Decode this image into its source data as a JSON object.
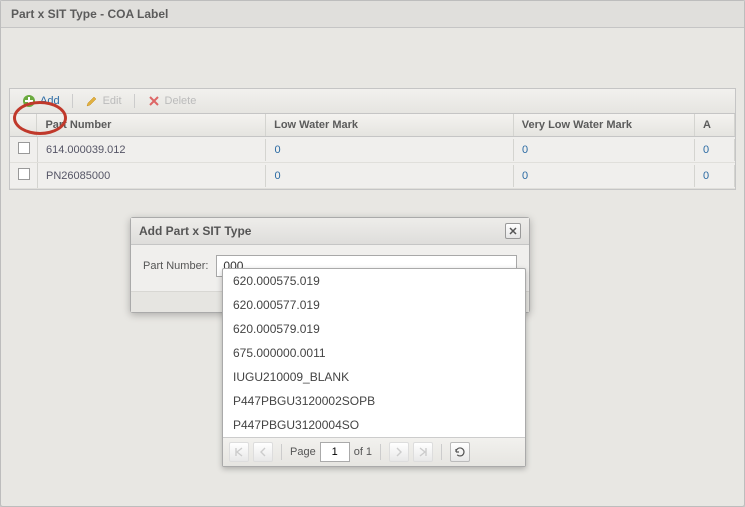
{
  "panel": {
    "title": "Part x SIT Type - COA Label"
  },
  "toolbar": {
    "add_label": "Add",
    "edit_label": "Edit",
    "delete_label": "Delete"
  },
  "grid": {
    "columns": {
      "part_number": "Part Number",
      "low_water": "Low Water Mark",
      "very_low_water": "Very Low Water Mark",
      "av": "A"
    },
    "rows": [
      {
        "part_number": "614.000039.012",
        "low_water": "0",
        "very_low_water": "0",
        "av": "0"
      },
      {
        "part_number": "PN26085000",
        "low_water": "0",
        "very_low_water": "0",
        "av": "0"
      }
    ]
  },
  "modal": {
    "title": "Add Part x SIT Type",
    "field_label": "Part Number:",
    "field_value": "000"
  },
  "dropdown": {
    "options": [
      "620.000575.019",
      "620.000577.019",
      "620.000579.019",
      "675.000000.0011",
      "IUGU210009_BLANK",
      "P447PBGU3120002SOPB",
      "P447PBGU3120004SO"
    ],
    "pager": {
      "page_label": "Page",
      "current": "1",
      "of_label": "of 1"
    }
  }
}
